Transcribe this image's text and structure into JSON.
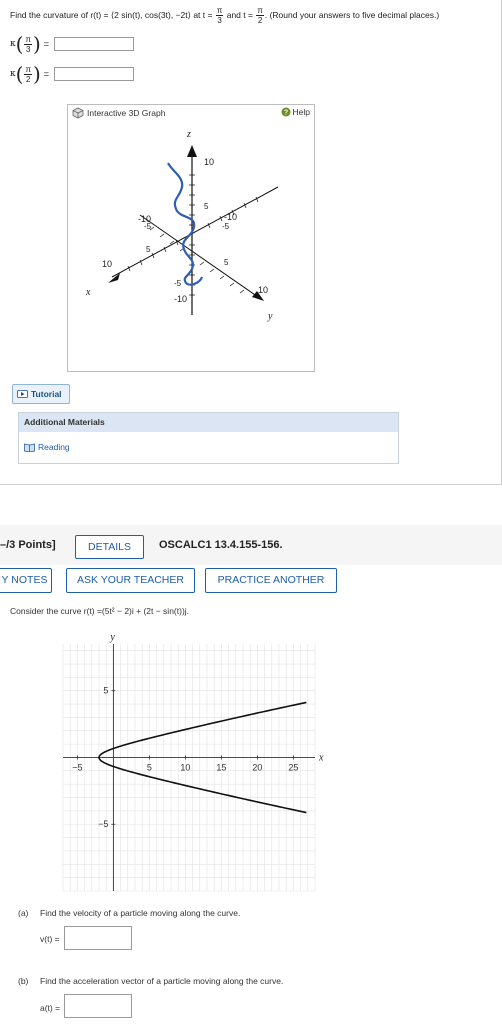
{
  "question1": {
    "prefix": "Find the curvature of r(t) = ",
    "vector": "⟨2 sin(t), cos(3t), −2t⟩",
    "at_text": " at t = ",
    "t1": {
      "num": "π",
      "den": "3"
    },
    "and_text": " and t = ",
    "t2": {
      "num": "π",
      "den": "2"
    },
    "suffix": ". (Round your answers to five decimal places.)",
    "kappa_symbol": "κ",
    "equals": "=",
    "answer1": "",
    "answer2": ""
  },
  "graph3d": {
    "title": "Interactive 3D Graph",
    "help_label": "Help",
    "axis_z": "z",
    "axis_x": "x",
    "axis_y": "y",
    "tick_z_10": "10",
    "tick_z_5": "5",
    "tick_z_m10": "-10",
    "tick_x_10": "10",
    "tick_x_5": "5",
    "tick_x_m5": "-5",
    "tick_x_m10": "-10",
    "tick_y_10": "10",
    "tick_y_5": "5",
    "tick_y_m5": "-5",
    "tick_y_m10": "-10",
    "tick_z_m5": "-5",
    "curve_color": "#2f5fb3"
  },
  "tutorial_label": "Tutorial",
  "additional_materials": {
    "heading": "Additional Materials",
    "reading_label": "Reading"
  },
  "question2": {
    "points": "–/3 Points]",
    "details_label": "DETAILS",
    "code": "OSCALC1 13.4.155-156.",
    "my_notes_label": "Y NOTES",
    "ask_teacher_label": "ASK YOUR TEACHER",
    "practice_label": "PRACTICE ANOTHER",
    "consider_text": "Consider the curve r(t) =(5t² − 2)i + (2t − sin(t))j.",
    "part_a_label": "(a)",
    "part_a_text": "Find the velocity of a particle moving along the curve.",
    "part_a_var": "v(t) =",
    "part_a_value": "",
    "part_b_label": "(b)",
    "part_b_text": "Find the acceleration vector of a particle moving along the curve.",
    "part_b_var": "a(t) =",
    "part_b_value": ""
  },
  "chart_data": {
    "type": "line",
    "title": "",
    "xlabel": "x",
    "ylabel": "y",
    "xlim": [
      -7,
      28
    ],
    "ylim": [
      -10,
      8.5
    ],
    "x_ticks": [
      -5,
      5,
      10,
      15,
      20,
      25
    ],
    "y_ticks": [
      5,
      -5
    ],
    "grid": true,
    "series": [
      {
        "curve": "r(t) = (5t^2 - 2, 2t - sin t)",
        "t_range": [
          -2.4,
          2.4
        ],
        "color": "#111111"
      }
    ]
  }
}
